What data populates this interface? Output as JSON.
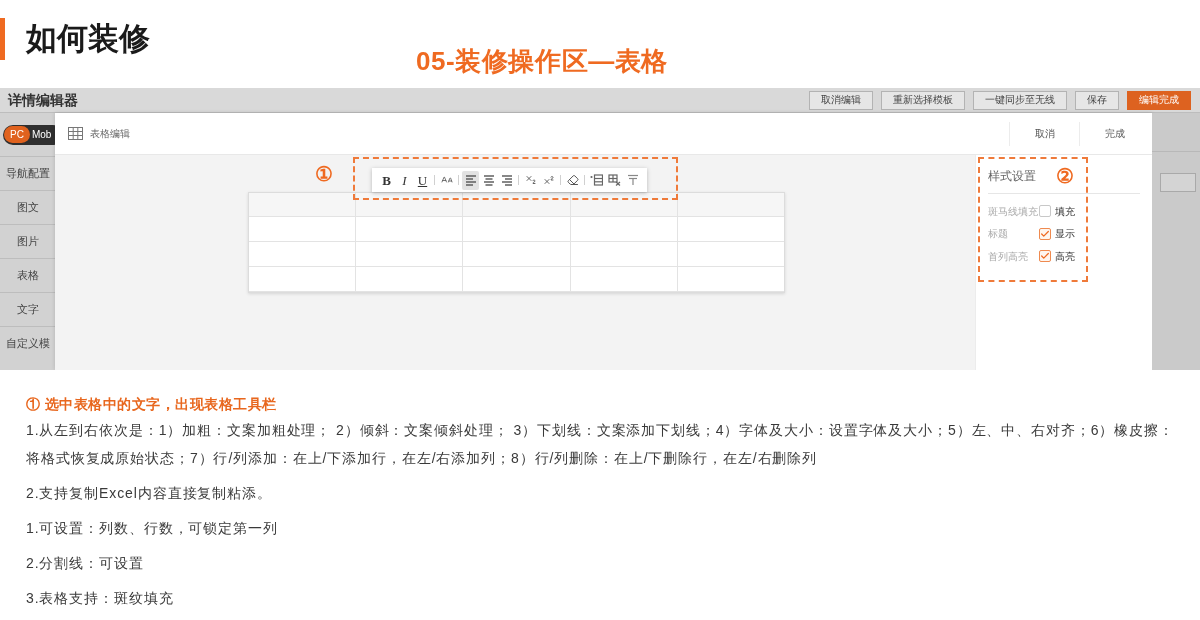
{
  "page": {
    "title": "如何装修",
    "subtitle": "05-装修操作区—表格"
  },
  "editor": {
    "title": "详情编辑器",
    "buttons": [
      {
        "label": "取消编辑",
        "primary": false
      },
      {
        "label": "重新选择模板",
        "primary": false
      },
      {
        "label": "一键同步至无线",
        "primary": false
      },
      {
        "label": "保存",
        "primary": false
      },
      {
        "label": "编辑完成",
        "primary": true
      }
    ]
  },
  "view_toggle": [
    {
      "label": "PC",
      "selected": true
    },
    {
      "label": "Mob",
      "selected": false
    }
  ],
  "sidebar": {
    "items": [
      {
        "label": "导航配置"
      },
      {
        "label": "图文"
      },
      {
        "label": "图片"
      },
      {
        "label": "表格"
      },
      {
        "label": "文字"
      },
      {
        "label": "自定义模"
      }
    ]
  },
  "dialog": {
    "title": "表格编辑",
    "buttons": [
      "取消",
      "完成"
    ]
  },
  "format_toolbar": {
    "callout": "①",
    "groups": [
      {
        "buttons": [
          {
            "kind": "bold",
            "label": "B",
            "active": false
          },
          {
            "kind": "italic",
            "label": "I",
            "active": false
          },
          {
            "kind": "underline",
            "label": "U",
            "active": false
          }
        ]
      },
      {
        "buttons": [
          {
            "kind": "font-size",
            "active": false
          }
        ]
      },
      {
        "buttons": [
          {
            "kind": "align-left",
            "active": true
          },
          {
            "kind": "align-center",
            "active": false
          },
          {
            "kind": "align-right",
            "active": false
          }
        ]
      },
      {
        "buttons": [
          {
            "kind": "subscript",
            "active": false
          },
          {
            "kind": "superscript",
            "active": false
          }
        ]
      },
      {
        "buttons": [
          {
            "kind": "eraser",
            "active": false
          }
        ]
      },
      {
        "buttons": [
          {
            "kind": "row-insert",
            "active": false
          },
          {
            "kind": "table-delete",
            "active": false
          },
          {
            "kind": "column-delete",
            "active": false
          }
        ]
      }
    ]
  },
  "table": {
    "rows": [
      {
        "kind": "header"
      },
      {
        "kind": "body"
      },
      {
        "kind": "body"
      },
      {
        "kind": "body"
      }
    ]
  },
  "style_settings": {
    "title": "样式设置",
    "callout": "②",
    "rows": [
      {
        "label": "斑马线填充",
        "option": "填充",
        "checked": false
      },
      {
        "label": "标题",
        "option": "显示",
        "checked": true
      },
      {
        "label": "首列高亮",
        "option": "高亮",
        "checked": true
      }
    ]
  },
  "notes": {
    "heading": "① 选中表格中的文字，出现表格工具栏",
    "paragraphs": [
      "1.从左到右依次是：1）加粗：文案加粗处理； 2）倾斜：文案倾斜处理； 3）下划线：文案添加下划线；4）字体及大小：设置字体及大小；5）左、中、右对齐；6）橡皮擦：将格式恢复成原始状态；7）行/列添加：在上/下添加行，在左/右添加列；8）行/列删除：在上/下删除行，在左/右删除列",
      "2.支持复制Excel内容直接复制粘添。",
      "1.可设置：列数、行数，可锁定第一列",
      "2.分割线：可设置",
      "3.表格支持：斑纹填充"
    ]
  }
}
